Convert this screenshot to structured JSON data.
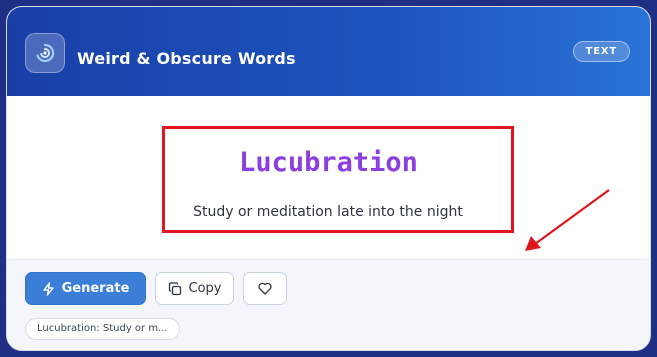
{
  "header": {
    "title": "Weird & Obscure Words",
    "badge": "TEXT"
  },
  "result": {
    "word": "Lucubration",
    "definition": "Study or meditation late into the night"
  },
  "actions": {
    "generate_label": "Generate",
    "copy_label": "Copy"
  },
  "history": {
    "items": [
      "Lucubration: Study or m..."
    ]
  },
  "annotation": {
    "box_color": "#e0161e"
  },
  "colors": {
    "header_start": "#1a3fa8",
    "header_end": "#2a73d6",
    "accent": "#3b7ed8",
    "word": "#8b3fe0"
  },
  "icons": {
    "app": "swirl-icon",
    "generate": "lightning-icon",
    "copy": "copy-icon",
    "favorite": "heart-icon"
  }
}
